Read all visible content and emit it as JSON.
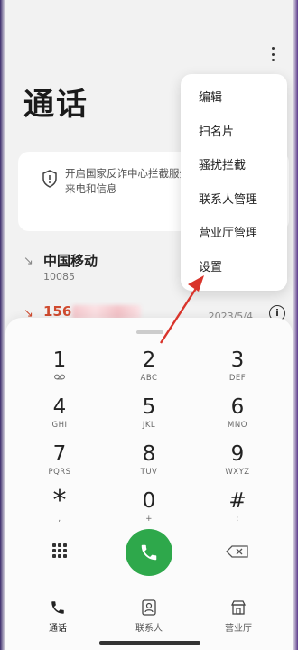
{
  "header": {
    "title": "通话",
    "more_icon": "more-vertical-icon"
  },
  "banner": {
    "icon": "shield-info-icon",
    "line1": "开启国家反诈中心拦截服务",
    "line2": "来电和信息"
  },
  "call_log": [
    {
      "direction": "incoming",
      "name": "中国移动",
      "number": "10085"
    },
    {
      "direction": "missed",
      "name": "156",
      "date": "2023/5/4",
      "color": "#d04b2f"
    }
  ],
  "menu": {
    "items": [
      {
        "label": "编辑"
      },
      {
        "label": "扫名片"
      },
      {
        "label": "骚扰拦截"
      },
      {
        "label": "联系人管理"
      },
      {
        "label": "营业厅管理"
      },
      {
        "label": "设置"
      }
    ]
  },
  "keypad": [
    {
      "digit": "1",
      "letters": ""
    },
    {
      "digit": "2",
      "letters": "ABC"
    },
    {
      "digit": "3",
      "letters": "DEF"
    },
    {
      "digit": "4",
      "letters": "GHI"
    },
    {
      "digit": "5",
      "letters": "JKL"
    },
    {
      "digit": "6",
      "letters": "MNO"
    },
    {
      "digit": "7",
      "letters": "PQRS"
    },
    {
      "digit": "8",
      "letters": "TUV"
    },
    {
      "digit": "9",
      "letters": "WXYZ"
    },
    {
      "digit": "*",
      "letters": ","
    },
    {
      "digit": "0",
      "letters": "+"
    },
    {
      "digit": "#",
      "letters": ";"
    }
  ],
  "nav": {
    "items": [
      {
        "label": "通话",
        "icon": "phone-icon"
      },
      {
        "label": "联系人",
        "icon": "contacts-icon"
      },
      {
        "label": "营业厅",
        "icon": "store-icon"
      }
    ]
  },
  "colors": {
    "call_button": "#2ea84b",
    "missed_call": "#d04b2f",
    "annotation_arrow": "#d9342b"
  }
}
